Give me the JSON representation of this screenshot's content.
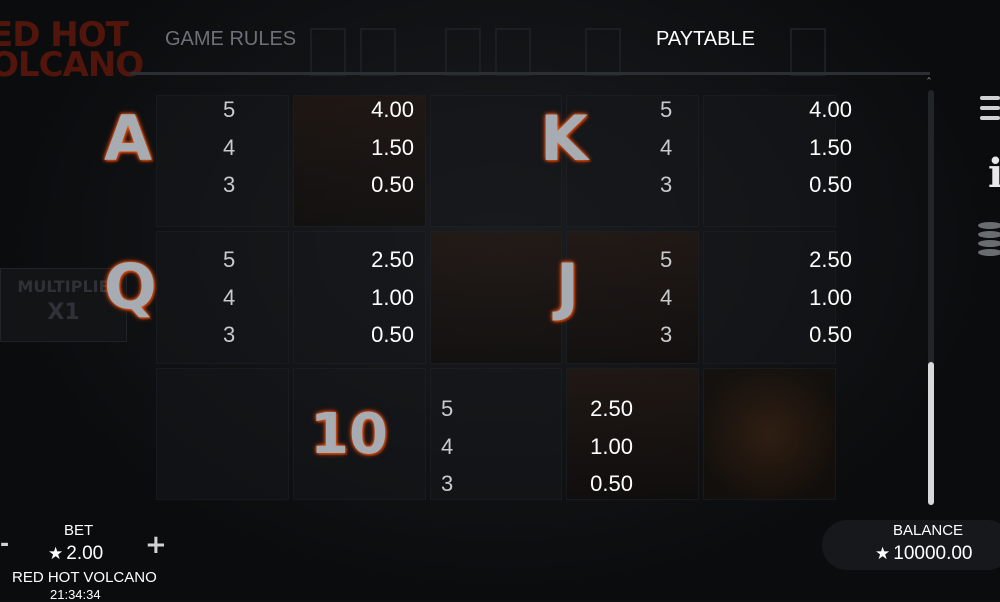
{
  "logo": {
    "line1": "ED HOT",
    "line2": "OLCANO"
  },
  "side": {
    "multiplier_label": "MULTIPLIE",
    "multiplier_value": "X1"
  },
  "tabs": {
    "rules": "GAME RULES",
    "paytable": "PAYTABLE"
  },
  "paytable": [
    {
      "symbol": "A",
      "counts": [
        "5",
        "4",
        "3"
      ],
      "amounts": [
        "4.00",
        "1.50",
        "0.50"
      ]
    },
    {
      "symbol": "K",
      "counts": [
        "5",
        "4",
        "3"
      ],
      "amounts": [
        "4.00",
        "1.50",
        "0.50"
      ]
    },
    {
      "symbol": "Q",
      "counts": [
        "5",
        "4",
        "3"
      ],
      "amounts": [
        "2.50",
        "1.00",
        "0.50"
      ]
    },
    {
      "symbol": "J",
      "counts": [
        "5",
        "4",
        "3"
      ],
      "amounts": [
        "2.50",
        "1.00",
        "0.50"
      ]
    },
    {
      "symbol": "10",
      "counts": [
        "5",
        "4",
        "3"
      ],
      "amounts": [
        "2.50",
        "1.00",
        "0.50"
      ]
    }
  ],
  "bottom": {
    "minus": "-",
    "plus": "+",
    "bet_label": "BET",
    "bet_value": "2.00",
    "game_name": "RED HOT VOLCANO",
    "time": "21:34:34",
    "balance_label": "BALANCE",
    "balance_value": "10000.00",
    "currency_symbol": "★"
  },
  "icons": {
    "menu": "menu-icon",
    "info": "info-icon",
    "coins": "coins-icon",
    "scroll_up": "chevron-up-icon"
  },
  "colors": {
    "accent_glow": "#ff6a1a",
    "muted_tab": "#6d7177"
  }
}
